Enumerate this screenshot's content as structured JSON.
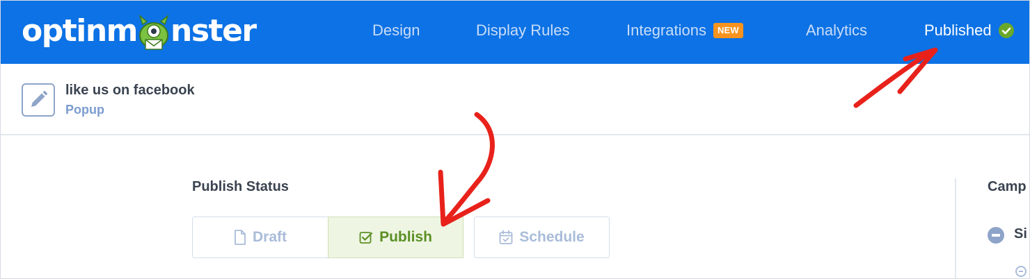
{
  "header": {
    "logo": {
      "prefix": "optinm",
      "suffix": "nster"
    },
    "nav": {
      "design": "Design",
      "display_rules": "Display Rules",
      "integrations": "Integrations",
      "integrations_badge": "NEW",
      "analytics": "Analytics",
      "published": "Published"
    }
  },
  "campaign": {
    "name": "like us on facebook",
    "type": "Popup"
  },
  "publish_status": {
    "title": "Publish Status",
    "draft": "Draft",
    "publish": "Publish",
    "schedule": "Schedule",
    "selected": "publish"
  },
  "sidebar": {
    "title": "Camp",
    "item": "Si"
  },
  "colors": {
    "header_bg": "#0d72e5",
    "badge_new": "#f7931e",
    "published_check": "#6aa829",
    "publish_active_bg": "#eef5e3",
    "annotation_arrow": "#e8221b"
  },
  "icons": {
    "edit": "pencil-icon",
    "draft": "document-icon",
    "publish": "check-square-icon",
    "schedule": "calendar-check-icon",
    "published": "check-circle-icon"
  }
}
